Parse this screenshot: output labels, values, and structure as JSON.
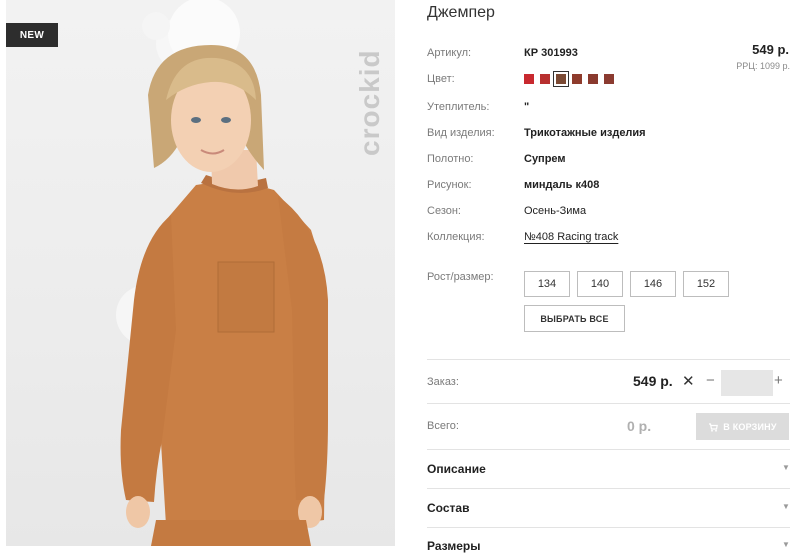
{
  "photo": {
    "badge": "NEW",
    "brand_watermark": "crockid"
  },
  "product": {
    "title": "Джемпер",
    "price": "549 р.",
    "rrp": "РРЦ: 1099 р."
  },
  "specs": {
    "article": {
      "label": "Артикул:",
      "value": "КР 301993"
    },
    "color": {
      "label": "Цвет:"
    },
    "insulation": {
      "label": "Утеплитель:",
      "value": "\""
    },
    "type": {
      "label": "Вид изделия:",
      "value": "Трикотажные изделия"
    },
    "fabric": {
      "label": "Полотно:",
      "value": "Супрем"
    },
    "pattern": {
      "label": "Рисунок:",
      "value": "миндаль к408"
    },
    "season": {
      "label": "Сезон:",
      "value": "Осень-Зима"
    },
    "collection": {
      "label": "Коллекция:",
      "value": "№408 Racing track"
    }
  },
  "swatches": [
    {
      "color": "#c8292f",
      "selected": false
    },
    {
      "color": "#b8302f",
      "selected": false
    },
    {
      "color": "#7b4a34",
      "selected": true
    },
    {
      "color": "#8e3b2c",
      "selected": false
    },
    {
      "color": "#8a3a2e",
      "selected": false
    },
    {
      "color": "#8b3b30",
      "selected": false
    }
  ],
  "sizes": {
    "label": "Рост/размер:",
    "options": [
      "134",
      "140",
      "146",
      "152"
    ],
    "select_all": "ВЫБРАТЬ ВСЕ"
  },
  "order": {
    "label": "Заказ:",
    "price": "549 р.",
    "remove_symbol": "✕",
    "minus_symbol": "−",
    "plus_symbol": "+",
    "quantity": ""
  },
  "total": {
    "label": "Всего:",
    "value": "0 р.",
    "cart_button": "В КОРЗИНУ"
  },
  "accordion": [
    {
      "title": "Описание"
    },
    {
      "title": "Состав"
    },
    {
      "title": "Размеры"
    }
  ]
}
